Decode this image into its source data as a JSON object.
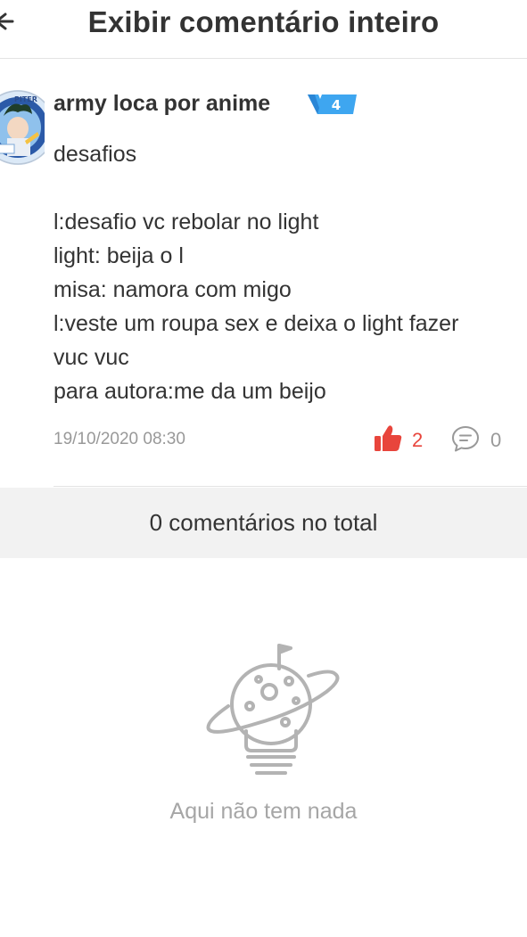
{
  "header": {
    "title": "Exibir comentário inteiro",
    "back_icon": "back-arrow-icon"
  },
  "comment": {
    "author": "army loca por anime",
    "level": "4",
    "lines": [
      "desafios",
      "",
      "l:desafio vc rebolar no light",
      "light: beija o l",
      "misa: namora com migo",
      "l:veste um roupa sex e deixa o light fazer",
      "vuc vuc",
      "para autora:me da um beijo"
    ],
    "timestamp": "19/10/2020 08:30",
    "likes": "2",
    "replies": "0"
  },
  "summary": {
    "total_label": "0 comentários no total"
  },
  "empty_state": {
    "message": "Aqui não tem nada",
    "icon": "lightbulb-planet-icon"
  },
  "colors": {
    "like_red": "#e8453c",
    "badge_blue": "#3ea6f0",
    "muted_gray": "#999999",
    "panel_gray": "#f2f2f2"
  }
}
